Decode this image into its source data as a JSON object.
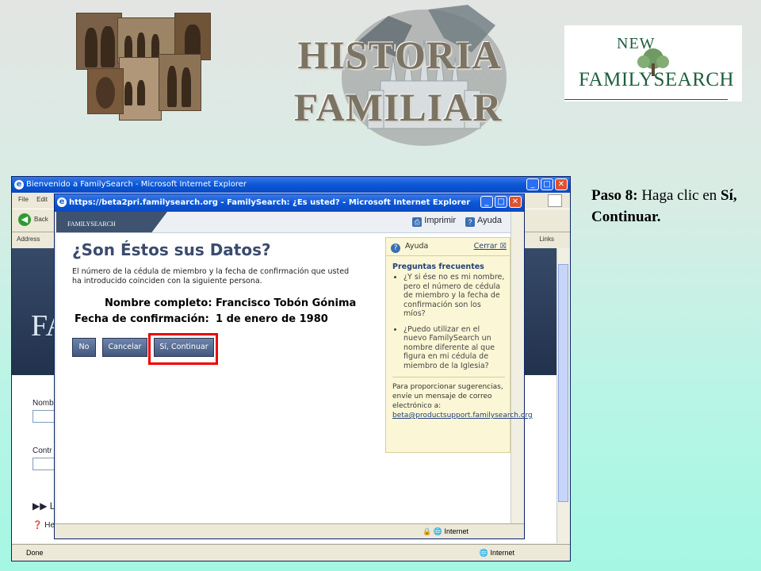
{
  "slide": {
    "title_line1": "HISTORIA",
    "title_line2": "FAMILIAR",
    "logo_new": "NEW",
    "logo_brand": "FAMILYSEARCH",
    "caption_step": "Paso 8:",
    "caption_text": "Haga clic en",
    "caption_target": "Sí, Continuar."
  },
  "outer_window": {
    "title": "Bienvenido a FamilySearch - Microsoft Internet Explorer",
    "menu": [
      "File",
      "Edit"
    ],
    "back_label": "Back",
    "address_label": "Address",
    "links_label": "Links",
    "page_fa": "FA",
    "field1": "Nomb",
    "field2": "Contr",
    "link1": "Le",
    "link2": "He",
    "status": "Done",
    "zone": "Internet"
  },
  "popup": {
    "title": "https://beta2pri.familysearch.org - FamilySearch: ¿Es usted? - Microsoft Internet Explorer",
    "brand": "FAMILYSEARCH",
    "print": "Imprimir",
    "help": "Ayuda",
    "heading": "¿Son Éstos sus Datos?",
    "lead": "El número de la cédula de miembro y la fecha de confirmación que usted ha introducido coinciden con la siguiente persona.",
    "name_label": "Nombre completo:",
    "name_value": "Francisco Tobón Gónima",
    "date_label": "Fecha de confirmación:",
    "date_value": "1 de enero de 1980",
    "btn_no": "No",
    "btn_cancel": "Cancelar",
    "btn_continue": "Sí, Continuar",
    "status_zone": "Internet"
  },
  "help_panel": {
    "title": "Ayuda",
    "close": "Cerrar",
    "faq_title": "Preguntas frecuentes",
    "faq": [
      "¿Y si ése no es mi nombre, pero el número de cédula de miembro y la fecha de confirmación son los míos?",
      "¿Puedo utilizar en el nuevo FamilySearch un nombre diferente al que figura en mi cédula de miembro de la Iglesia?"
    ],
    "suggestions": "Para proporcionar sugerencias, envíe un mensaje de correo electrónico a:",
    "email": "beta@productsupport.familysearch.org"
  }
}
